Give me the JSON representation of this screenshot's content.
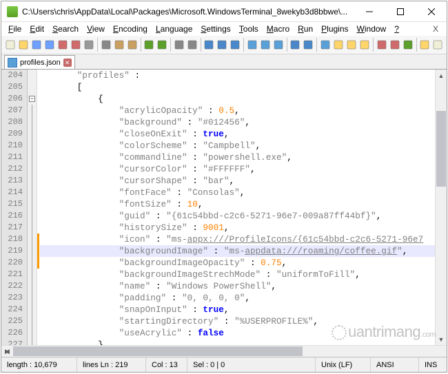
{
  "title": "C:\\Users\\chris\\AppData\\Local\\Packages\\Microsoft.WindowsTerminal_8wekyb3d8bbwe\\...",
  "menus": [
    "File",
    "Edit",
    "Search",
    "View",
    "Encoding",
    "Language",
    "Settings",
    "Tools",
    "Macro",
    "Run",
    "Plugins",
    "Window",
    "?"
  ],
  "menu_close": "X",
  "tab": {
    "name": "profiles.json"
  },
  "gutter_start": 204,
  "gutter_count": 24,
  "code_lines": [
    {
      "t": [
        [
          "str",
          "\"profiles\""
        ],
        [
          "pun",
          " :"
        ]
      ],
      "indent": 3
    },
    {
      "t": [
        [
          "pun",
          "["
        ]
      ],
      "indent": 3
    },
    {
      "t": [
        [
          "pun",
          "{"
        ]
      ],
      "indent": 5,
      "fold": "minus"
    },
    {
      "t": [
        [
          "str",
          "\"acrylicOpacity\""
        ],
        [
          "pun",
          " : "
        ],
        [
          "num",
          "0.5"
        ],
        [
          "pun",
          ","
        ]
      ],
      "indent": 7
    },
    {
      "t": [
        [
          "str",
          "\"background\""
        ],
        [
          "pun",
          " : "
        ],
        [
          "str",
          "\"#012456\""
        ],
        [
          "pun",
          ","
        ]
      ],
      "indent": 7
    },
    {
      "t": [
        [
          "str",
          "\"closeOnExit\""
        ],
        [
          "pun",
          " : "
        ],
        [
          "kw",
          "true"
        ],
        [
          "pun",
          ","
        ]
      ],
      "indent": 7
    },
    {
      "t": [
        [
          "str",
          "\"colorScheme\""
        ],
        [
          "pun",
          " : "
        ],
        [
          "str",
          "\"Campbell\""
        ],
        [
          "pun",
          ","
        ]
      ],
      "indent": 7
    },
    {
      "t": [
        [
          "str",
          "\"commandline\""
        ],
        [
          "pun",
          " : "
        ],
        [
          "str",
          "\"powershell.exe\""
        ],
        [
          "pun",
          ","
        ]
      ],
      "indent": 7
    },
    {
      "t": [
        [
          "str",
          "\"cursorColor\""
        ],
        [
          "pun",
          " : "
        ],
        [
          "str",
          "\"#FFFFFF\""
        ],
        [
          "pun",
          ","
        ]
      ],
      "indent": 7
    },
    {
      "t": [
        [
          "str",
          "\"cursorShape\""
        ],
        [
          "pun",
          " : "
        ],
        [
          "str",
          "\"bar\""
        ],
        [
          "pun",
          ","
        ]
      ],
      "indent": 7
    },
    {
      "t": [
        [
          "str",
          "\"fontFace\""
        ],
        [
          "pun",
          " : "
        ],
        [
          "str",
          "\"Consolas\""
        ],
        [
          "pun",
          ","
        ]
      ],
      "indent": 7
    },
    {
      "t": [
        [
          "str",
          "\"fontSize\""
        ],
        [
          "pun",
          " : "
        ],
        [
          "num",
          "10"
        ],
        [
          "pun",
          ","
        ]
      ],
      "indent": 7
    },
    {
      "t": [
        [
          "str",
          "\"guid\""
        ],
        [
          "pun",
          " : "
        ],
        [
          "str",
          "\"{61c54bbd-c2c6-5271-96e7-009a87ff44bf}\""
        ],
        [
          "pun",
          ","
        ]
      ],
      "indent": 7
    },
    {
      "t": [
        [
          "str",
          "\"historySize\""
        ],
        [
          "pun",
          " : "
        ],
        [
          "num",
          "9001"
        ],
        [
          "pun",
          ","
        ]
      ],
      "indent": 7
    },
    {
      "t": [
        [
          "str",
          "\"icon\""
        ],
        [
          "pun",
          " : "
        ],
        [
          "str",
          "\"ms-"
        ],
        [
          "url",
          "appx:///ProfileIcons/{61c54bbd-c2c6-5271-96e7"
        ]
      ],
      "indent": 7
    },
    {
      "t": [
        [
          "str",
          "\"backgroundImage\""
        ],
        [
          "pun",
          " : "
        ],
        [
          "str",
          "\"ms-"
        ],
        [
          "url",
          "appdata:///roaming/coffee.gif"
        ],
        [
          "str",
          "\""
        ],
        [
          "pun",
          ","
        ]
      ],
      "indent": 7,
      "hl": true
    },
    {
      "t": [
        [
          "str",
          "\"backgroundImageOpacity\""
        ],
        [
          "pun",
          " : "
        ],
        [
          "num",
          "0.75"
        ],
        [
          "pun",
          ","
        ]
      ],
      "indent": 7
    },
    {
      "t": [
        [
          "str",
          "\"backgroundImageStrechMode\""
        ],
        [
          "pun",
          " : "
        ],
        [
          "str",
          "\"uniformToFill\""
        ],
        [
          "pun",
          ","
        ]
      ],
      "indent": 7
    },
    {
      "t": [
        [
          "str",
          "\"name\""
        ],
        [
          "pun",
          " : "
        ],
        [
          "str",
          "\"Windows PowerShell\""
        ],
        [
          "pun",
          ","
        ]
      ],
      "indent": 7
    },
    {
      "t": [
        [
          "str",
          "\"padding\""
        ],
        [
          "pun",
          " : "
        ],
        [
          "str",
          "\"0, 0, 0, 0\""
        ],
        [
          "pun",
          ","
        ]
      ],
      "indent": 7
    },
    {
      "t": [
        [
          "str",
          "\"snapOnInput\""
        ],
        [
          "pun",
          " : "
        ],
        [
          "kw",
          "true"
        ],
        [
          "pun",
          ","
        ]
      ],
      "indent": 7
    },
    {
      "t": [
        [
          "str",
          "\"startingDirectory\""
        ],
        [
          "pun",
          " : "
        ],
        [
          "str",
          "\"%USERPROFILE%\""
        ],
        [
          "pun",
          ","
        ]
      ],
      "indent": 7
    },
    {
      "t": [
        [
          "str",
          "\"useAcrylic\""
        ],
        [
          "pun",
          " : "
        ],
        [
          "kw",
          "false"
        ]
      ],
      "indent": 7
    },
    {
      "t": [
        [
          "pun",
          "},"
        ]
      ],
      "indent": 5
    }
  ],
  "toolbar_icons": [
    "new-file",
    "open-file",
    "save-file",
    "save-all",
    "close",
    "close-all",
    "print",
    "sep",
    "cut",
    "copy",
    "paste",
    "sep",
    "undo",
    "redo",
    "sep",
    "find",
    "replace",
    "sep",
    "zoom-in",
    "zoom-out",
    "sync",
    "sep",
    "wrap",
    "show-all",
    "indent-guide",
    "sep",
    "fold-all",
    "unfold-all",
    "sep",
    "hidden-chars",
    "doc-map",
    "func-list",
    "folder",
    "sep",
    "monitor",
    "record",
    "play",
    "sep",
    "spell",
    "doc"
  ],
  "toolbar_colors": {
    "new-file": "#f0f0d8",
    "open-file": "#ffd56b",
    "save-file": "#6ea0ff",
    "save-all": "#6ea0ff",
    "close": "#d06b6b",
    "close-all": "#d06b6b",
    "print": "#999",
    "cut": "#888",
    "copy": "#c9a062",
    "paste": "#c9a062",
    "undo": "#5aa02a",
    "redo": "#5aa02a",
    "find": "#888",
    "replace": "#888",
    "zoom-in": "#4a88c9",
    "zoom-out": "#4a88c9",
    "sync": "#4a88c9",
    "wrap": "#5aa0d8",
    "show-all": "#5aa0d8",
    "indent-guide": "#5aa0d8",
    "fold-all": "#4a88c9",
    "unfold-all": "#4a88c9",
    "hidden-chars": "#5aa0d8",
    "doc-map": "#ffd56b",
    "func-list": "#ffd56b",
    "folder": "#ffd56b",
    "monitor": "#d06b6b",
    "record": "#d06b6b",
    "play": "#5aa02a",
    "spell": "#ffd56b",
    "doc": "#f0f0d8"
  },
  "status": {
    "length": "length : 10,679",
    "lines_pos": "lines Ln : 219",
    "col": "Col : 13",
    "sel": "Sel : 0 | 0",
    "eol": "Unix (LF)",
    "enc": "ANSI",
    "ins": "INS"
  },
  "watermark": "uantrimang"
}
